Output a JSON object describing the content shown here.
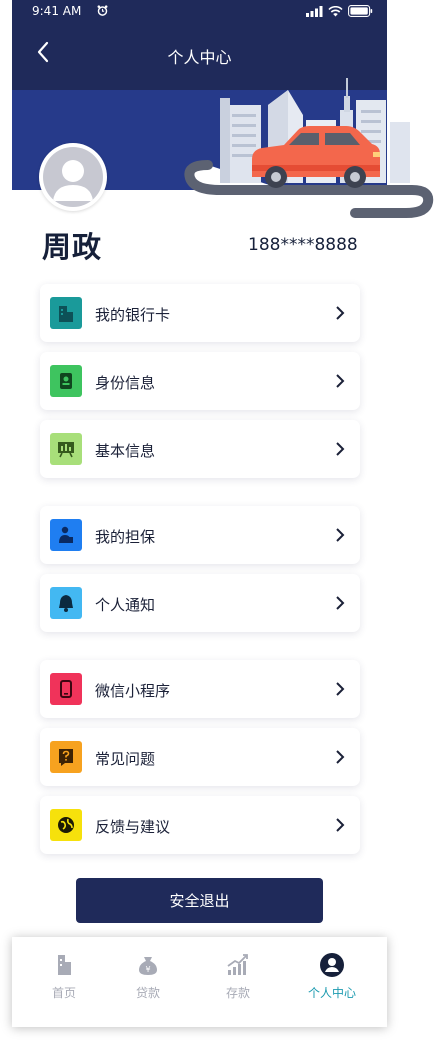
{
  "status_bar": {
    "time": "9:41 AM"
  },
  "header": {
    "title": "个人中心"
  },
  "user": {
    "name": "周政",
    "phone": "188****8888"
  },
  "menu": [
    {
      "label": "我的银行卡",
      "icon": "bank-card-icon",
      "color": "#1a9a9a"
    },
    {
      "label": "身份信息",
      "icon": "id-info-icon",
      "color": "#3ec45f"
    },
    {
      "label": "基本信息",
      "icon": "basic-info-icon",
      "color": "#a8df7a"
    },
    {
      "label": "我的担保",
      "icon": "guarantee-icon",
      "color": "#1f7ef1"
    },
    {
      "label": "个人通知",
      "icon": "bell-icon",
      "color": "#43b8f2"
    },
    {
      "label": "微信小程序",
      "icon": "mini-program-icon",
      "color": "#f0335a"
    },
    {
      "label": "常见问题",
      "icon": "question-icon",
      "color": "#f7a21f"
    },
    {
      "label": "反馈与建议",
      "icon": "feedback-icon",
      "color": "#f6e10c"
    }
  ],
  "logout": {
    "label": "安全退出"
  },
  "tabs": [
    {
      "label": "首页",
      "icon": "home-building-icon"
    },
    {
      "label": "贷款",
      "icon": "loan-moneybag-icon"
    },
    {
      "label": "存款",
      "icon": "deposit-chart-icon"
    },
    {
      "label": "个人中心",
      "icon": "profile-icon",
      "active": true
    }
  ],
  "colors": {
    "nav_bg": "#1f2a5a",
    "banner_bg": "#263a8a",
    "active_tab": "#1d9bb0",
    "inactive_tab": "#a8abb6"
  }
}
